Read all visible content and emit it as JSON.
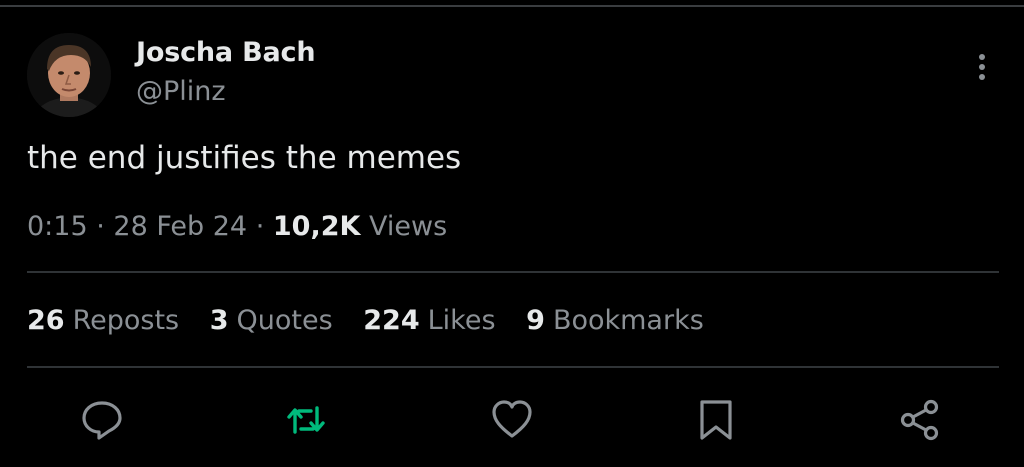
{
  "author": {
    "name": "Joscha Bach",
    "handle": "@Plinz"
  },
  "tweet": {
    "text": "the end justifies the memes",
    "time": "0:15",
    "date": "28 Feb 24",
    "views_count": "10,2K",
    "views_label": "Views",
    "separator": "·"
  },
  "stats": {
    "reposts": {
      "count": "26",
      "label": "Reposts"
    },
    "quotes": {
      "count": "3",
      "label": "Quotes"
    },
    "likes": {
      "count": "224",
      "label": "Likes"
    },
    "bookmarks": {
      "count": "9",
      "label": "Bookmarks"
    }
  },
  "icons": {
    "more": "more-vertical-icon",
    "reply": "reply-icon",
    "repost": "repost-icon",
    "like": "heart-icon",
    "bookmark": "bookmark-icon",
    "share": "share-icon"
  },
  "colors": {
    "background": "#000000",
    "text_primary": "#e7e9ea",
    "text_secondary": "#8b9095",
    "divider": "#2f3336",
    "repost_active": "#00ba7c"
  }
}
